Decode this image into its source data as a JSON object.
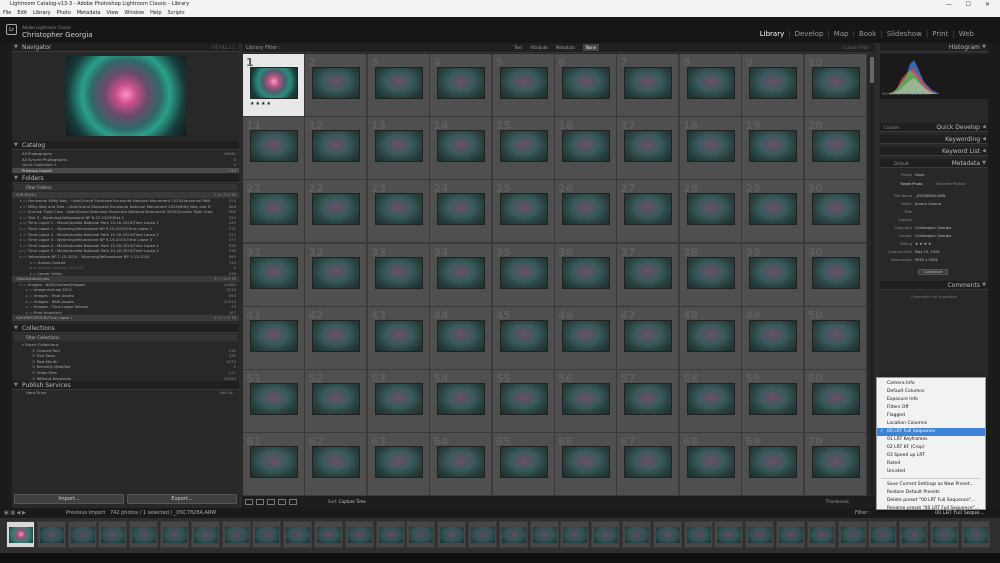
{
  "window": {
    "title": "Lightroom Catalog-v13-3 - Adobe Photoshop Lightroom Classic - Library",
    "controls": "—  ☐  ✕"
  },
  "menu": [
    "File",
    "Edit",
    "Library",
    "Photo",
    "Metadata",
    "View",
    "Window",
    "Help",
    "Scripts"
  ],
  "identity": {
    "app_name": "Adobe Lightroom Classic",
    "user": "Christopher Georgia"
  },
  "modules": [
    "Library",
    "Develop",
    "Map",
    "Book",
    "Slideshow",
    "Print",
    "Web"
  ],
  "active_module": "Library",
  "navigator": {
    "title": "Navigator",
    "zoom": "FIT  FILL  1:1"
  },
  "catalog": {
    "title": "Catalog",
    "items": [
      {
        "label": "All Photographs",
        "count": "28941"
      },
      {
        "label": "All Synced Photographs",
        "count": "0"
      },
      {
        "label": "Quick Collection +",
        "count": "0"
      },
      {
        "label": "Previous Import",
        "count": "742"
      }
    ]
  },
  "folders": {
    "title": "Folders",
    "filter": "Filter Folders",
    "volume1": {
      "label": "478 M (H:)",
      "info": "1.9 / 3.6 TB"
    },
    "items": [
      {
        "label": "Horizontal Milky Way - Utah\\Grand Staircase Escalante National Monument 2024\\Horizontal Milk",
        "count": "524"
      },
      {
        "label": "Milky Way and Tree - Utah\\Grand Staircase Escalante National Monument 2024\\Milky Way and Tr",
        "count": "886"
      },
      {
        "label": "Sunrise Tight Crop - Utah\\Grand Staircase Escalante National Monument 2024\\Sunrise Tight Crop",
        "count": "900"
      },
      {
        "label": "Test 3 - Wyoming\\Yellowstone NP 6-22-2024\\Test 3",
        "count": "334"
      },
      {
        "label": "Time Lapse 1 - Maine\\Acadia National Park 10-16-2024\\Time Lapse 1",
        "count": "249"
      },
      {
        "label": "Time Lapse 1 - Wyoming\\Yellowstone NP 9-19-2024\\Time Lapse 1",
        "count": "275"
      },
      {
        "label": "Time Lapse 2 - Maine\\Acadia National Park 10-16-2024\\Time Lapse 2",
        "count": "372"
      },
      {
        "label": "Time Lapse 3 - Wyoming\\Yellowstone NP 9-19-2024\\Time Lapse 3",
        "count": "277"
      },
      {
        "label": "Time Lapse 4 - Maine\\Acadia National Park 10-16-2024\\Time Lapse 4",
        "count": "930"
      },
      {
        "label": "Time Lapse 5 - Maine\\Acadia National Park 10-16-2024\\Time Lapse 5",
        "count": "336"
      },
      {
        "label": "Yellowstone NP 1-15-2024 - Wyoming\\Yellowstone NP 1-15-2024",
        "count": "990"
      },
      {
        "label": "Aurora Corona",
        "count": "742"
      },
      {
        "label": "Aurora Corona_2024-03",
        "count": "0"
      },
      {
        "label": "Lamar Valley",
        "count": "248"
      }
    ],
    "volume2": {
      "label": "\\\\Workstation\\nas",
      "info": "3.7 / 4.9 TB"
    },
    "nas_items": [
      {
        "label": "Images - NAS\\Content\\Images",
        "count": "24085"
      },
      {
        "label": "Image Archive 2022",
        "count": "2219"
      },
      {
        "label": "Images - Final Assets",
        "count": "894"
      },
      {
        "label": "Images - RAW Assets",
        "count": "20412"
      },
      {
        "label": "Images - Time Lapse Selects",
        "count": "53"
      },
      {
        "label": "Print Inventory",
        "count": "187"
      }
    ],
    "volume3": {
      "label": "\\\\WORKSTATION\\Time Lapse I",
      "info": "1.3 / 1.6 TB"
    }
  },
  "collections": {
    "title": "Collections",
    "filter": "Filter Collections",
    "items": [
      {
        "label": "Smart Collections",
        "count": ""
      },
      {
        "label": "Colored Red",
        "count": "110"
      },
      {
        "label": "Five Stars",
        "count": "333"
      },
      {
        "label": "Past Month",
        "count": "4270"
      },
      {
        "label": "Recently Modified",
        "count": "1"
      },
      {
        "label": "Video Files",
        "count": "117"
      },
      {
        "label": "Without Keywords",
        "count": "28334"
      }
    ]
  },
  "publish": {
    "title": "Publish Services",
    "item": "Hard Drive",
    "item_extra": "Set Up..."
  },
  "left_buttons": {
    "import": "Import...",
    "export": "Export..."
  },
  "filterbar": {
    "title": "Library Filter :",
    "tabs": [
      "Text",
      "Attribute",
      "Metadata",
      "None"
    ],
    "active_tab": "None",
    "custom": "Custom Filter"
  },
  "grid": {
    "selected_index": 1,
    "start_number": 1,
    "cells": 70,
    "stars": "★★★★"
  },
  "toolbar": {
    "sort_label": "Sort:",
    "sort_value": "Capture Time",
    "thumbs_label": "Thumbnails"
  },
  "right_panels": {
    "histogram": "Histogram",
    "histo_info": "ISO 800   14 mm   f/2.8   1/5 sec",
    "quick_develop": "Quick Develop",
    "quick_preset": "Custom",
    "keywording": "Keywording",
    "keyword_list": "Keyword List",
    "metadata": "Metadata",
    "metadata_mode": "Default",
    "preset_label": "Preset",
    "preset_value": "None",
    "target_photo": "Target Photo",
    "selected_photos": "Selected Photos",
    "fields": [
      {
        "k": "File Name",
        "v": "_DSC8639A.ARW"
      },
      {
        "k": "Folder",
        "v": "Aurora Corona"
      },
      {
        "k": "Title",
        "v": ""
      },
      {
        "k": "Caption",
        "v": ""
      },
      {
        "k": "Copyright",
        "v": "Christopher Georgia"
      },
      {
        "k": "Creator",
        "v": "Christopher Georgia"
      },
      {
        "k": "Rating",
        "v": "★ ★ ★ ★"
      },
      {
        "k": "Capture Date",
        "v": "May 10, 2024"
      },
      {
        "k": "Dimensions",
        "v": "9952 x 5304"
      }
    ],
    "customize": "Customize",
    "comments": "Comments",
    "comments_note": "Comments not supported"
  },
  "dropdown": {
    "items": [
      "Camera Info",
      "Default Columns",
      "Exposure Info",
      "Filters Off",
      "Flagged",
      "Location Columns",
      "00 LRT Full Sequence",
      "01 LRT Keyframes",
      "02 LRT KF (Crop)",
      "03 Speed up LRT",
      "Rated",
      "Unrated"
    ],
    "selected": "00 LRT Full Sequence",
    "actions": [
      "Save Current Settings as New Preset...",
      "Restore Default Presets",
      "Delete preset \"00 LRT Full Sequence\"...",
      "Rename preset \"00 LRT Full Sequence\"..."
    ]
  },
  "filmstrip_bar": {
    "source": "Previous Import",
    "status": "742 photos / 1 selected / _DSC7828A.ARW",
    "filter_label": "Filter :",
    "filter_value": "00 LRT Full Seque..."
  },
  "filmstrip": {
    "count": 32,
    "selected_index": 0
  }
}
